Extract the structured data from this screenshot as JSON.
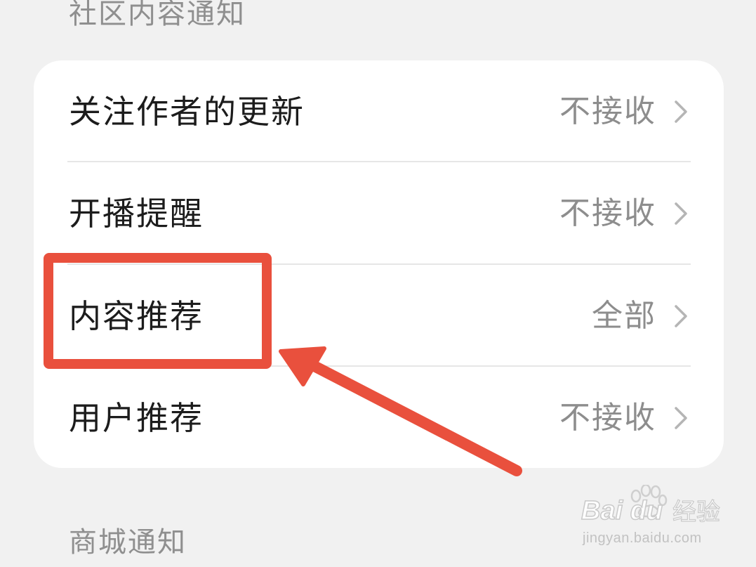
{
  "sections": {
    "community_title": "社区内容通知",
    "mall_title": "商城通知"
  },
  "rows": [
    {
      "label": "关注作者的更新",
      "value": "不接收"
    },
    {
      "label": "开播提醒",
      "value": "不接收"
    },
    {
      "label": "内容推荐",
      "value": "全部"
    },
    {
      "label": "用户推荐",
      "value": "不接收"
    }
  ],
  "annotation": {
    "highlight_color": "#e9503d",
    "highlighted_row": "内容推荐"
  },
  "watermark": {
    "logo": "Bai du",
    "brand": "经验",
    "url": "jingyan.baidu.com"
  },
  "icons": {
    "row_chevron": "chevron-right-icon"
  }
}
